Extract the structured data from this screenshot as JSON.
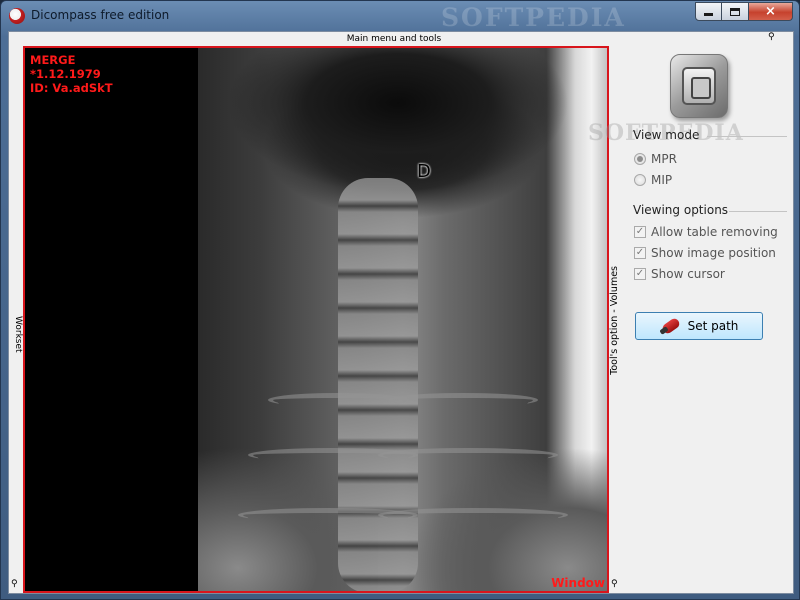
{
  "window": {
    "title": "Dicompass free edition",
    "watermark": "SOFTPEDIA",
    "close_glyph": "×"
  },
  "menu": {
    "header_label": "Main menu and tools",
    "pin_glyph": "⚲"
  },
  "workset": {
    "label": "Workset"
  },
  "viewer": {
    "overlay": {
      "line1": "MERGE",
      "line2": "*1.12.1979",
      "line3": "ID: Va.adSkT"
    },
    "marker": "D",
    "window_label": "Window",
    "accent_color": "#d8151c"
  },
  "tools": {
    "label": "Tool's option - Volumes"
  },
  "panel": {
    "watermark": "SOFTPEDIA",
    "view_mode": {
      "title": "View mode",
      "options": [
        {
          "label": "MPR",
          "selected": true
        },
        {
          "label": "MIP",
          "selected": false
        }
      ]
    },
    "viewing_options": {
      "title": "Viewing options",
      "items": [
        {
          "label": "Allow table removing",
          "checked": true
        },
        {
          "label": "Show image position",
          "checked": true
        },
        {
          "label": "Show cursor",
          "checked": true
        }
      ],
      "check_glyph": "✓"
    },
    "set_path_label": "Set path"
  }
}
